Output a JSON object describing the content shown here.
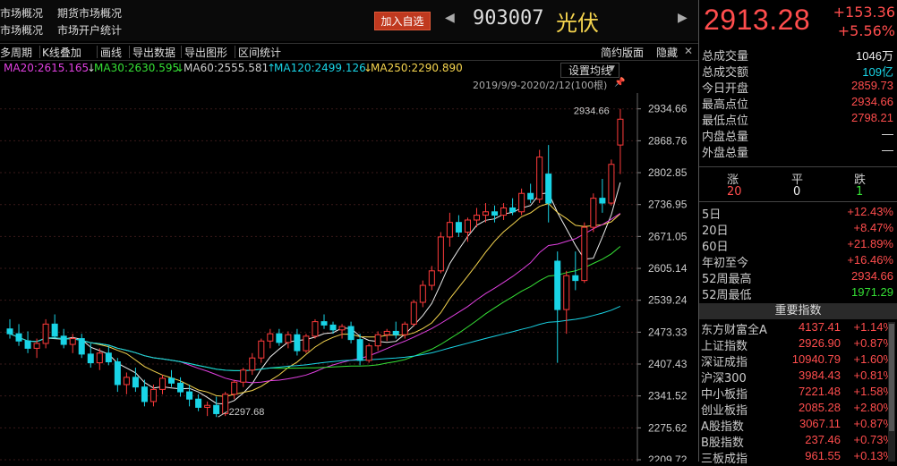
{
  "header": {
    "nav": [
      "市场概况",
      "期货市场概况",
      "市场概况",
      "市场开户统计"
    ],
    "add_watch": "加入自选",
    "code": "903007",
    "name": "光伏",
    "price": "2913.28",
    "change": "+153.36",
    "change_pct": "+5.56%"
  },
  "toolbar": {
    "items": [
      "多周期",
      "K线叠加",
      "画线",
      "导出数据",
      "导出图形",
      "区间统计"
    ],
    "right_items": [
      "简约版面",
      "隐藏"
    ]
  },
  "ma": [
    {
      "label": "MA20:2615.165",
      "arrow": "",
      "color": "#e040e0"
    },
    {
      "label": "MA30:2630.595",
      "arrow": "↓",
      "color": "#35e035"
    },
    {
      "label": "MA60:2555.581",
      "arrow": "↓",
      "color": "#cccccc"
    },
    {
      "label": "MA120:2499.126",
      "arrow": "↑",
      "color": "#19d4e6"
    },
    {
      "label": "MA250:2290.890",
      "arrow": "↓",
      "color": "#f5d44e"
    }
  ],
  "settings_button": "设置均线",
  "date_range": "2019/9/9-2020/2/12(100根)",
  "chart_data": {
    "type": "candlestick",
    "y_ticks": [
      2934.66,
      2868.76,
      2802.85,
      2736.95,
      2671.05,
      2605.14,
      2539.24,
      2473.33,
      2407.43,
      2341.52,
      2275.62,
      2209.72
    ],
    "y_tick_labels": [
      "2934.66",
      "2868.76",
      "2802.85",
      "2736.95",
      "2671.05",
      "2605.14",
      "2539.24",
      "2473.33",
      "2407.43",
      "2341.52",
      "2275.62",
      "2209.72"
    ],
    "ylim": [
      2209.72,
      2960
    ],
    "high_annotation": "2934.66",
    "low_annotation": "2297.68",
    "grid": true,
    "candles": [
      {
        "o": 2480,
        "h": 2500,
        "l": 2460,
        "c": 2470
      },
      {
        "o": 2470,
        "h": 2490,
        "l": 2445,
        "c": 2455
      },
      {
        "o": 2455,
        "h": 2475,
        "l": 2430,
        "c": 2440
      },
      {
        "o": 2440,
        "h": 2460,
        "l": 2420,
        "c": 2450
      },
      {
        "o": 2450,
        "h": 2500,
        "l": 2440,
        "c": 2490
      },
      {
        "o": 2490,
        "h": 2510,
        "l": 2460,
        "c": 2465
      },
      {
        "o": 2465,
        "h": 2480,
        "l": 2440,
        "c": 2448
      },
      {
        "o": 2448,
        "h": 2470,
        "l": 2430,
        "c": 2460
      },
      {
        "o": 2460,
        "h": 2470,
        "l": 2420,
        "c": 2428
      },
      {
        "o": 2428,
        "h": 2450,
        "l": 2400,
        "c": 2410
      },
      {
        "o": 2410,
        "h": 2440,
        "l": 2395,
        "c": 2430
      },
      {
        "o": 2430,
        "h": 2445,
        "l": 2405,
        "c": 2412
      },
      {
        "o": 2412,
        "h": 2420,
        "l": 2350,
        "c": 2365
      },
      {
        "o": 2365,
        "h": 2390,
        "l": 2345,
        "c": 2380
      },
      {
        "o": 2380,
        "h": 2400,
        "l": 2350,
        "c": 2360
      },
      {
        "o": 2360,
        "h": 2375,
        "l": 2320,
        "c": 2330
      },
      {
        "o": 2330,
        "h": 2365,
        "l": 2320,
        "c": 2355
      },
      {
        "o": 2355,
        "h": 2385,
        "l": 2345,
        "c": 2378
      },
      {
        "o": 2378,
        "h": 2395,
        "l": 2360,
        "c": 2368
      },
      {
        "o": 2368,
        "h": 2380,
        "l": 2340,
        "c": 2350
      },
      {
        "o": 2350,
        "h": 2365,
        "l": 2320,
        "c": 2335
      },
      {
        "o": 2335,
        "h": 2345,
        "l": 2310,
        "c": 2318
      },
      {
        "o": 2318,
        "h": 2330,
        "l": 2300,
        "c": 2322
      },
      {
        "o": 2322,
        "h": 2340,
        "l": 2298,
        "c": 2305
      },
      {
        "o": 2305,
        "h": 2350,
        "l": 2300,
        "c": 2345
      },
      {
        "o": 2345,
        "h": 2375,
        "l": 2335,
        "c": 2370
      },
      {
        "o": 2370,
        "h": 2400,
        "l": 2360,
        "c": 2395
      },
      {
        "o": 2395,
        "h": 2430,
        "l": 2385,
        "c": 2420
      },
      {
        "o": 2420,
        "h": 2460,
        "l": 2410,
        "c": 2455
      },
      {
        "o": 2455,
        "h": 2480,
        "l": 2440,
        "c": 2470
      },
      {
        "o": 2470,
        "h": 2480,
        "l": 2445,
        "c": 2452
      },
      {
        "o": 2452,
        "h": 2475,
        "l": 2440,
        "c": 2468
      },
      {
        "o": 2468,
        "h": 2480,
        "l": 2425,
        "c": 2435
      },
      {
        "o": 2435,
        "h": 2470,
        "l": 2430,
        "c": 2465
      },
      {
        "o": 2465,
        "h": 2500,
        "l": 2460,
        "c": 2495
      },
      {
        "o": 2495,
        "h": 2510,
        "l": 2480,
        "c": 2488
      },
      {
        "o": 2488,
        "h": 2495,
        "l": 2470,
        "c": 2478
      },
      {
        "o": 2478,
        "h": 2490,
        "l": 2460,
        "c": 2485
      },
      {
        "o": 2485,
        "h": 2495,
        "l": 2450,
        "c": 2458
      },
      {
        "o": 2458,
        "h": 2470,
        "l": 2405,
        "c": 2415
      },
      {
        "o": 2415,
        "h": 2450,
        "l": 2410,
        "c": 2445
      },
      {
        "o": 2445,
        "h": 2475,
        "l": 2435,
        "c": 2468
      },
      {
        "o": 2468,
        "h": 2480,
        "l": 2455,
        "c": 2475
      },
      {
        "o": 2475,
        "h": 2495,
        "l": 2460,
        "c": 2468
      },
      {
        "o": 2468,
        "h": 2495,
        "l": 2460,
        "c": 2490
      },
      {
        "o": 2490,
        "h": 2540,
        "l": 2485,
        "c": 2535
      },
      {
        "o": 2535,
        "h": 2580,
        "l": 2525,
        "c": 2570
      },
      {
        "o": 2570,
        "h": 2610,
        "l": 2560,
        "c": 2600
      },
      {
        "o": 2600,
        "h": 2680,
        "l": 2595,
        "c": 2670
      },
      {
        "o": 2670,
        "h": 2720,
        "l": 2650,
        "c": 2700
      },
      {
        "o": 2700,
        "h": 2715,
        "l": 2670,
        "c": 2680
      },
      {
        "o": 2680,
        "h": 2710,
        "l": 2660,
        "c": 2705
      },
      {
        "o": 2705,
        "h": 2730,
        "l": 2690,
        "c": 2715
      },
      {
        "o": 2715,
        "h": 2740,
        "l": 2700,
        "c": 2722
      },
      {
        "o": 2722,
        "h": 2735,
        "l": 2700,
        "c": 2715
      },
      {
        "o": 2715,
        "h": 2740,
        "l": 2705,
        "c": 2730
      },
      {
        "o": 2730,
        "h": 2750,
        "l": 2715,
        "c": 2722
      },
      {
        "o": 2722,
        "h": 2770,
        "l": 2715,
        "c": 2760
      },
      {
        "o": 2760,
        "h": 2780,
        "l": 2740,
        "c": 2748
      },
      {
        "o": 2748,
        "h": 2850,
        "l": 2740,
        "c": 2835
      },
      {
        "o": 2800,
        "h": 2860,
        "l": 2700,
        "c": 2740
      },
      {
        "o": 2620,
        "h": 2640,
        "l": 2410,
        "c": 2520
      },
      {
        "o": 2520,
        "h": 2600,
        "l": 2470,
        "c": 2590
      },
      {
        "o": 2590,
        "h": 2640,
        "l": 2560,
        "c": 2580
      },
      {
        "o": 2580,
        "h": 2700,
        "l": 2575,
        "c": 2690
      },
      {
        "o": 2690,
        "h": 2760,
        "l": 2680,
        "c": 2750
      },
      {
        "o": 2750,
        "h": 2790,
        "l": 2720,
        "c": 2740
      },
      {
        "o": 2740,
        "h": 2830,
        "l": 2735,
        "c": 2820
      },
      {
        "o": 2860,
        "h": 2934.66,
        "l": 2800,
        "c": 2913.28
      }
    ]
  },
  "panel": {
    "stats": [
      {
        "label": "总成交量",
        "value": "1046万",
        "cls": "white"
      },
      {
        "label": "总成交额",
        "value": "109亿",
        "cls": "cyan"
      },
      {
        "label": "今日开盘",
        "value": "2859.73",
        "cls": "red"
      },
      {
        "label": "最高点位",
        "value": "2934.66",
        "cls": "red"
      },
      {
        "label": "最低点位",
        "value": "2798.21",
        "cls": "red"
      },
      {
        "label": "内盘总量",
        "value": "—",
        "cls": "white"
      },
      {
        "label": "外盘总量",
        "value": "—",
        "cls": "white"
      }
    ],
    "breadth_labels": [
      "涨",
      "平",
      "跌"
    ],
    "breadth_values": [
      "20",
      "0",
      "1"
    ],
    "perf": [
      {
        "label": "5日",
        "value": "+12.43%",
        "cls": "red"
      },
      {
        "label": "20日",
        "value": "+8.47%",
        "cls": "red"
      },
      {
        "label": "60日",
        "value": "+21.89%",
        "cls": "red"
      },
      {
        "label": "年初至今",
        "value": "+16.46%",
        "cls": "red"
      },
      {
        "label": "52周最高",
        "value": "2934.66",
        "cls": "red"
      },
      {
        "label": "52周最低",
        "value": "1971.29",
        "cls": "green"
      }
    ],
    "index_title": "重要指数",
    "indices": [
      {
        "name": "东方财富全A",
        "price": "4137.41",
        "chg": "+1.14%"
      },
      {
        "name": "上证指数",
        "price": "2926.90",
        "chg": "+0.87%"
      },
      {
        "name": "深证成指",
        "price": "10940.79",
        "chg": "+1.60%"
      },
      {
        "name": "沪深300",
        "price": "3984.43",
        "chg": "+0.81%"
      },
      {
        "name": "中小板指",
        "price": "7221.48",
        "chg": "+1.58%"
      },
      {
        "name": "创业板指",
        "price": "2085.28",
        "chg": "+2.80%"
      },
      {
        "name": "A股指数",
        "price": "3067.11",
        "chg": "+0.87%"
      },
      {
        "name": "B股指数",
        "price": "237.46",
        "chg": "+0.73%"
      },
      {
        "name": "三板成指",
        "price": "961.55",
        "chg": "+0.13%"
      }
    ]
  }
}
